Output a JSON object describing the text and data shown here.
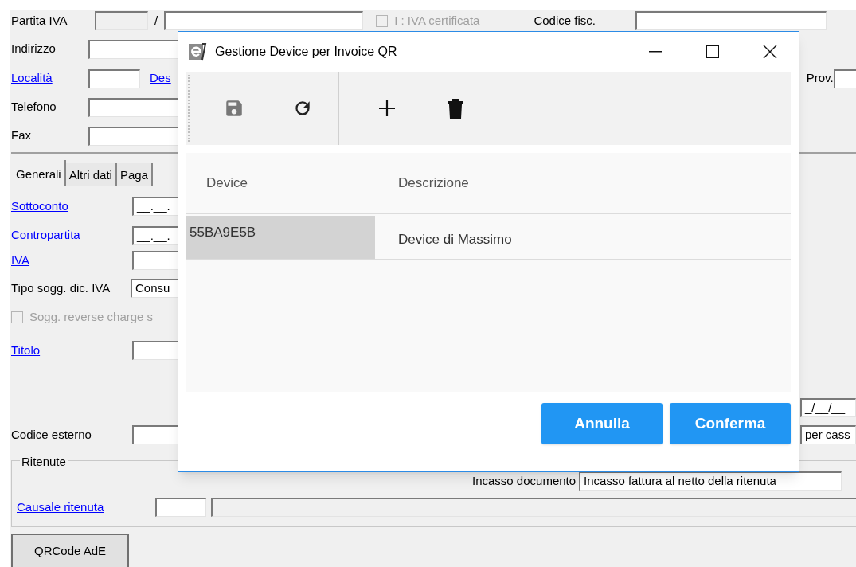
{
  "form": {
    "partita_iva": {
      "label": "Partita IVA",
      "separator": "/"
    },
    "iva_certificata": {
      "label": "I : IVA certificata",
      "checked": false,
      "disabled": true
    },
    "codice_fiscale": {
      "label": "Codice fisc."
    },
    "indirizzo": {
      "label": "Indirizzo"
    },
    "localita": {
      "label": "Località",
      "link_2": "Des"
    },
    "provincia": {
      "label": "Prov."
    },
    "telefono": {
      "label": "Telefono"
    },
    "fax": {
      "label": "Fax"
    },
    "tabs": [
      {
        "label": "Generali",
        "selected": true
      },
      {
        "label": "Altri dati",
        "selected": false
      },
      {
        "label": "Paga",
        "selected": false
      }
    ],
    "sottoconto": {
      "label": "Sottoconto",
      "value": "__.__."
    },
    "contropartita": {
      "label": "Contropartita",
      "value": "__.__."
    },
    "iva": {
      "label": "IVA"
    },
    "tipo_sogg": {
      "label": "Tipo sogg. dic. IVA",
      "value": "Consu"
    },
    "reverse_charge": {
      "label": "Sogg. reverse charge s",
      "checked": false,
      "disabled": true
    },
    "titolo": {
      "label": "Titolo"
    },
    "date_field": {
      "value": "_/__/__"
    },
    "codice_esterno": {
      "label": "Codice esterno"
    },
    "per_cassa": {
      "value": "per cass"
    },
    "ritenute": {
      "title": "Ritenute",
      "incasso_label": "Incasso documento",
      "incasso_value": "Incasso fattura al netto della ritenuta",
      "causale_label": "Causale ritenuta"
    },
    "qrcode_button": "QRCode AdE"
  },
  "dialog": {
    "title": "Gestione Device per Invoice QR",
    "columns": [
      "Device",
      "Descrizione"
    ],
    "rows": [
      {
        "device": "55BA9E5B",
        "description": "Device di Massimo",
        "selected": true
      }
    ],
    "buttons": [
      "Annulla",
      "Conferma"
    ]
  }
}
